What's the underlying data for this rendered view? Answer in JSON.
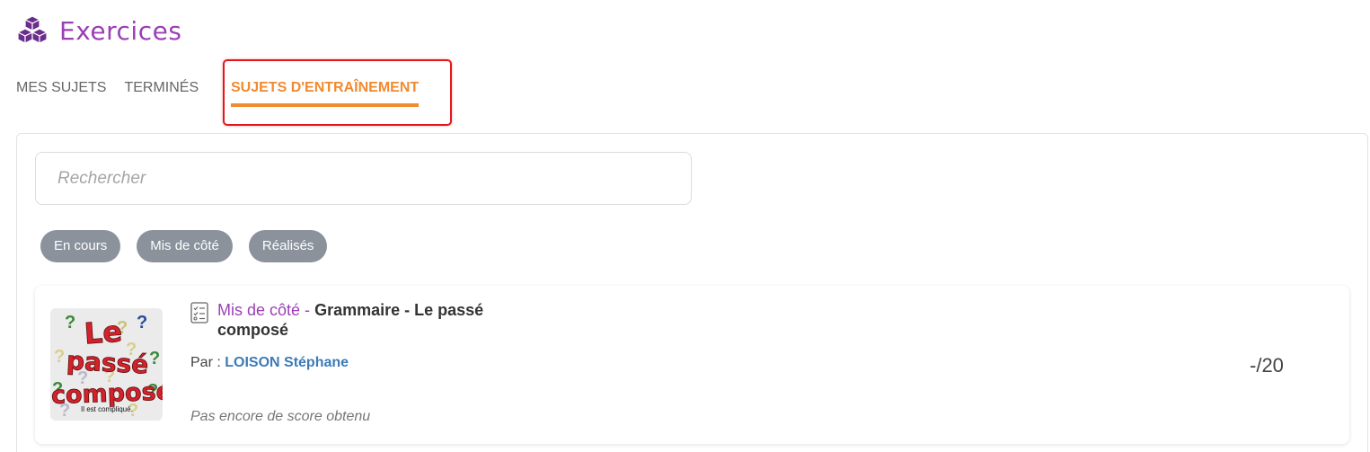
{
  "header": {
    "title": "Exercices",
    "icon": "cubes-icon",
    "accent_color": "#9b3fb5"
  },
  "tabs": [
    {
      "label": "MES SUJETS",
      "active": false
    },
    {
      "label": "TERMINÉS",
      "active": false
    },
    {
      "label": "SUJETS D'ENTRAÎNEMENT",
      "active": true
    }
  ],
  "active_tab_color": "#f28a2e",
  "highlight_color": "#e3161b",
  "search": {
    "placeholder": "Rechercher",
    "value": ""
  },
  "filters": [
    {
      "label": "En cours"
    },
    {
      "label": "Mis de côté"
    },
    {
      "label": "Réalisés"
    }
  ],
  "filter_color": "#8b929c",
  "exercise": {
    "icon": "checklist-icon",
    "status": "Mis de côté -",
    "title": "Grammaire - Le passé composé",
    "author_prefix": "Par :",
    "author": "LOISON Stéphane",
    "score": "-/20",
    "score_note": "Pas encore de score obtenu",
    "thumbnail": {
      "line1": "Le",
      "line2": "passé",
      "line3": "composé",
      "caption": "Il est compliqué."
    }
  }
}
